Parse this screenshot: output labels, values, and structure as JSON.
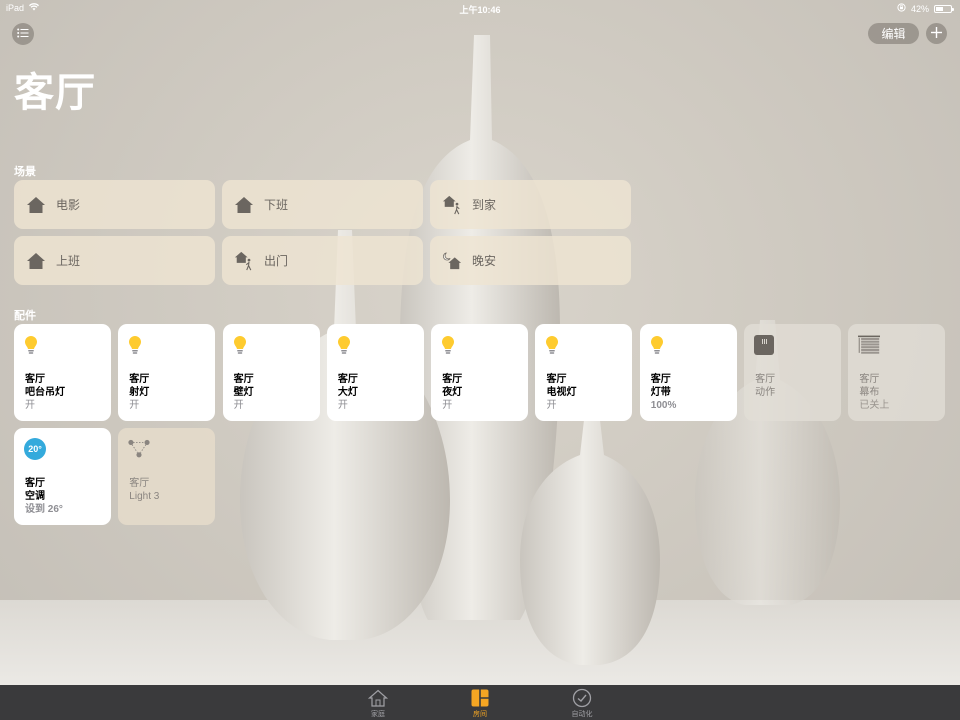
{
  "status_bar": {
    "device": "iPad",
    "time": "上午10:46",
    "battery": "42%",
    "battery_level": 0.42
  },
  "header": {
    "title": "客厅",
    "edit_label": "编辑"
  },
  "scenes": {
    "label": "场景",
    "items": [
      {
        "name": "电影",
        "icon": "house-icon"
      },
      {
        "name": "下班",
        "icon": "house-icon"
      },
      {
        "name": "到家",
        "icon": "house-arrive-icon"
      },
      {
        "name": "上班",
        "icon": "house-icon"
      },
      {
        "name": "出门",
        "icon": "house-leave-icon"
      },
      {
        "name": "晚安",
        "icon": "house-moon-icon"
      }
    ]
  },
  "accessories": {
    "label": "配件",
    "items": [
      {
        "room": "客厅",
        "name": "吧台吊灯",
        "status": "开",
        "icon": "bulb-icon",
        "state": "on"
      },
      {
        "room": "客厅",
        "name": "射灯",
        "status": "开",
        "icon": "bulb-icon",
        "state": "on"
      },
      {
        "room": "客厅",
        "name": "壁灯",
        "status": "开",
        "icon": "bulb-icon",
        "state": "on"
      },
      {
        "room": "客厅",
        "name": "大灯",
        "status": "开",
        "icon": "bulb-icon",
        "state": "on"
      },
      {
        "room": "客厅",
        "name": "夜灯",
        "status": "开",
        "icon": "bulb-icon",
        "state": "on"
      },
      {
        "room": "客厅",
        "name": "电视灯",
        "status": "开",
        "icon": "bulb-icon",
        "state": "on"
      },
      {
        "room": "客厅",
        "name": "灯带",
        "status": "100%",
        "icon": "bulb-icon",
        "state": "on"
      },
      {
        "room": "客厅",
        "name": "动作",
        "status": "",
        "icon": "switch-icon",
        "state": "off"
      },
      {
        "room": "客厅",
        "name": "幕布",
        "status": "已关上",
        "icon": "blinds-icon",
        "state": "off"
      },
      {
        "room": "客厅",
        "name": "空调",
        "status": "设到 26°",
        "icon": "thermostat-icon",
        "state": "on",
        "temperature": "20°"
      },
      {
        "room": "客厅",
        "name": "Light 3",
        "status": "",
        "icon": "bridge-icon",
        "state": "dim"
      }
    ]
  },
  "tab_bar": {
    "items": [
      {
        "label": "家庭",
        "icon": "home-tab-icon",
        "active": false
      },
      {
        "label": "房间",
        "icon": "rooms-tab-icon",
        "active": true
      },
      {
        "label": "自动化",
        "icon": "automation-tab-icon",
        "active": false
      }
    ]
  },
  "colors": {
    "bulb": "#fecb2f",
    "accent": "#f5a623",
    "thermostat": "#34aadc"
  }
}
